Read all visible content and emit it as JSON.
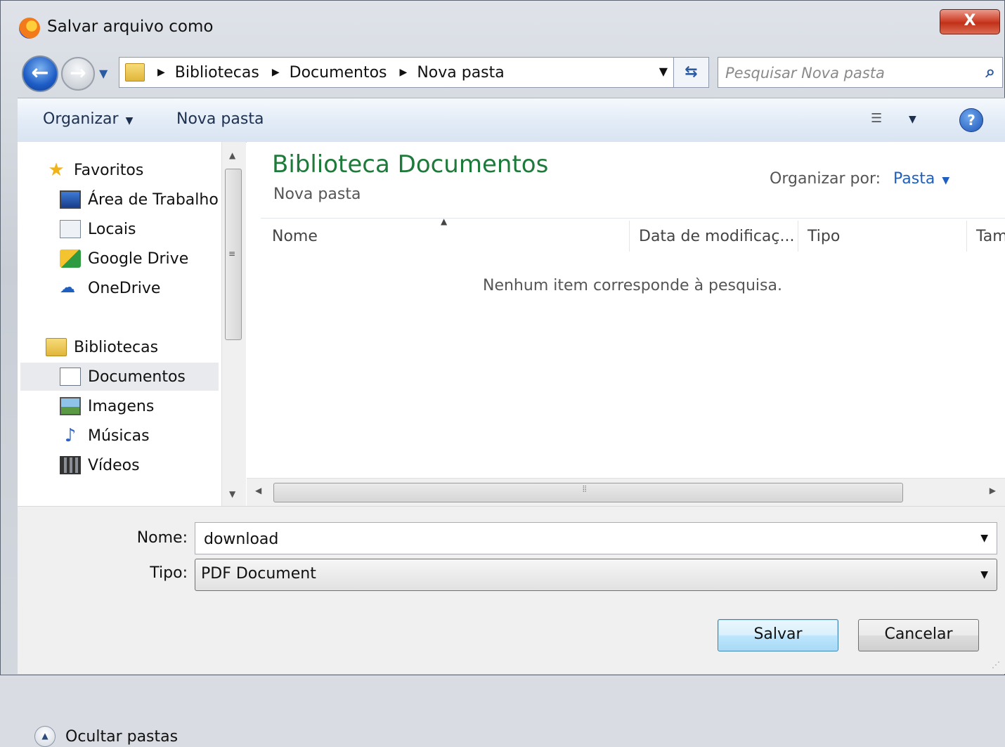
{
  "window": {
    "title": "Salvar arquivo como",
    "close_label": "X"
  },
  "nav": {
    "breadcrumbs": [
      "Bibliotecas",
      "Documentos",
      "Nova pasta"
    ],
    "search_placeholder": "Pesquisar Nova pasta"
  },
  "toolbar": {
    "organize_label": "Organizar",
    "new_folder_label": "Nova pasta",
    "help_label": "?"
  },
  "sidebar": {
    "favorites": {
      "label": "Favoritos",
      "items": [
        {
          "label": "Área de Trabalho",
          "icon": "desktop-icon"
        },
        {
          "label": "Locais",
          "icon": "recent-places-icon"
        },
        {
          "label": "Google Drive",
          "icon": "google-drive-icon"
        },
        {
          "label": "OneDrive",
          "icon": "onedrive-icon"
        }
      ]
    },
    "libraries": {
      "label": "Bibliotecas",
      "items": [
        {
          "label": "Documentos",
          "icon": "documents-icon",
          "selected": true
        },
        {
          "label": "Imagens",
          "icon": "pictures-icon"
        },
        {
          "label": "Músicas",
          "icon": "music-icon"
        },
        {
          "label": "Vídeos",
          "icon": "videos-icon"
        }
      ]
    }
  },
  "content": {
    "library_title": "Biblioteca Documentos",
    "library_subtitle": "Nova pasta",
    "arrange_label": "Organizar por:",
    "arrange_value": "Pasta",
    "columns": [
      "Nome",
      "Data de modificaç...",
      "Tipo",
      "Tam"
    ],
    "empty_message": "Nenhum item corresponde à pesquisa."
  },
  "form": {
    "name_label": "Nome:",
    "name_value": "download",
    "type_label": "Tipo:",
    "type_value": "PDF Document",
    "hide_folders_label": "Ocultar pastas",
    "save_label": "Salvar",
    "cancel_label": "Cancelar"
  },
  "colors": {
    "library_title": "#1e7a3a",
    "link_blue": "#1f5fbf",
    "close_red": "#c1311a"
  }
}
